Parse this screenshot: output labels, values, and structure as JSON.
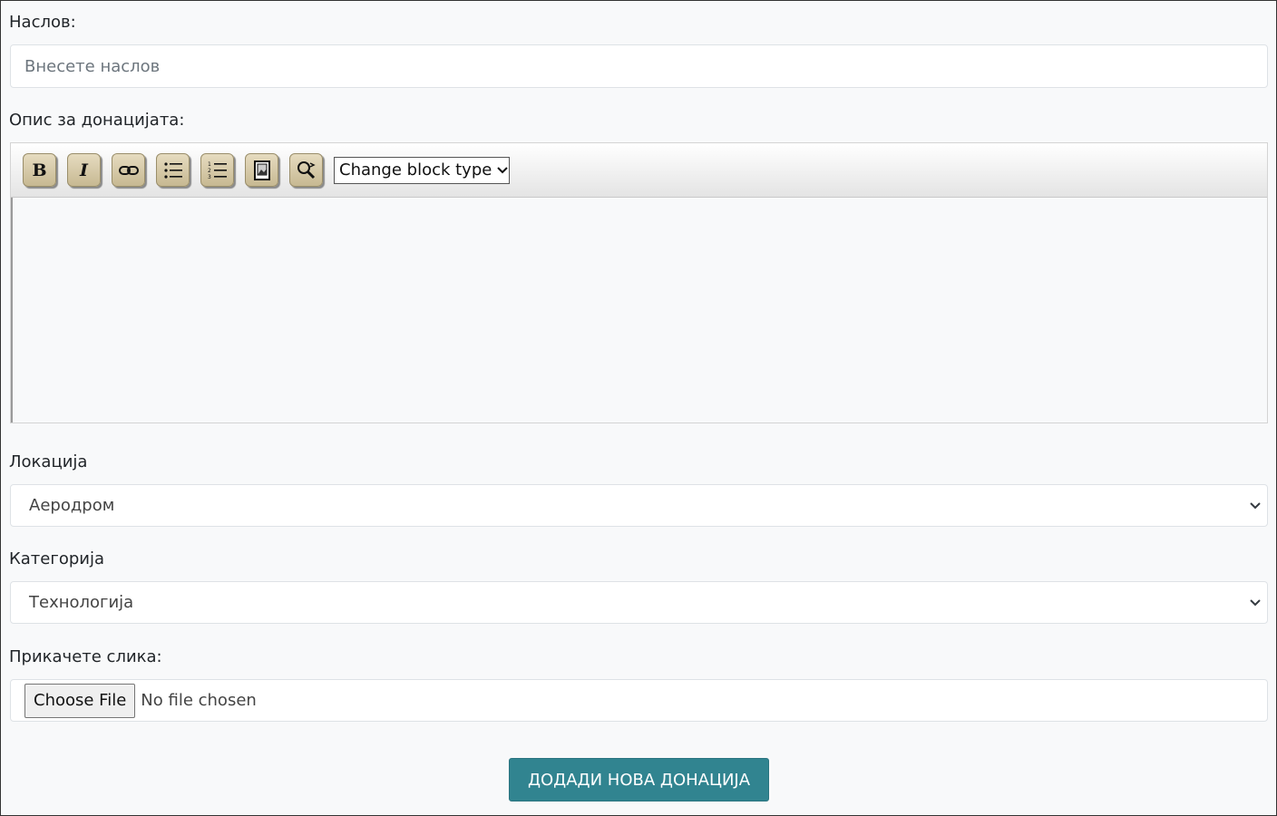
{
  "title_field": {
    "label": "Наслов:",
    "placeholder": "Внесете наслов",
    "value": ""
  },
  "description_field": {
    "label": "Опис за донацијата:",
    "toolbar": {
      "bold_label": "B",
      "italic_label": "I",
      "block_type_label": "Change block type",
      "icons": [
        "bold-icon",
        "italic-icon",
        "link-icon",
        "bulleted-list-icon",
        "numbered-list-icon",
        "image-icon",
        "preview-icon"
      ]
    }
  },
  "location_field": {
    "label": "Локација",
    "selected": "Аеродром"
  },
  "category_field": {
    "label": "Категорија",
    "selected": "Технологија"
  },
  "image_field": {
    "label": "Прикачете слика:",
    "button_label": "Choose File",
    "status": "No file chosen"
  },
  "submit": {
    "label": "ДОДАДИ НОВА ДОНАЦИЈА"
  },
  "colors": {
    "submit_bg": "#318490",
    "page_bg": "#f8f9fa",
    "toolbar_button": "#d8cca8"
  }
}
